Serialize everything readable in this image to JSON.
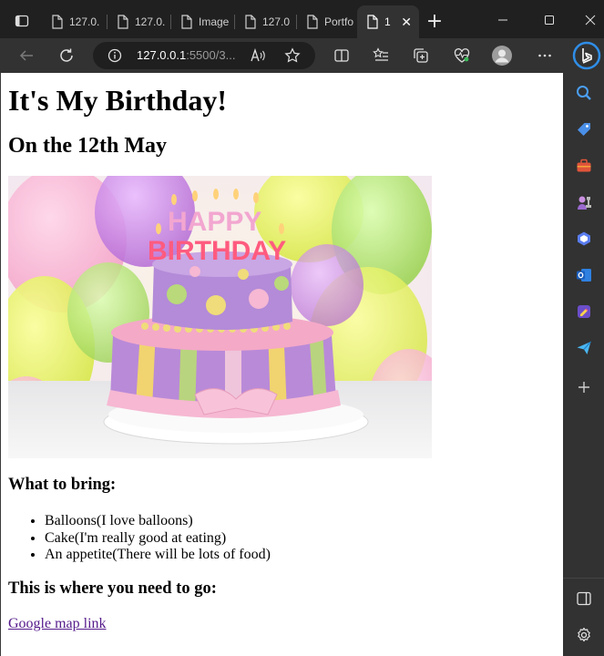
{
  "browser": {
    "tabs": [
      {
        "label": "127.0.",
        "active": false
      },
      {
        "label": "127.0.",
        "active": false
      },
      {
        "label": "Image",
        "active": false
      },
      {
        "label": "127.0",
        "active": false
      },
      {
        "label": "Portfo",
        "active": false
      },
      {
        "label": "1",
        "active": true
      }
    ],
    "new_tab_label": "+",
    "close_tab_label": "✕",
    "address": {
      "host": "127.0.0.1",
      "rest": ":5500/3..."
    },
    "toolbar_icons": [
      "back-icon",
      "refresh-icon",
      "info-icon",
      "read-aloud-icon",
      "favorite-star-icon",
      "split-screen-icon",
      "favorites-icon",
      "collections-icon",
      "browser-essentials-icon",
      "profile-avatar",
      "more-menu-icon"
    ],
    "sidebar_icons": [
      "search-icon",
      "shopping-tag-icon",
      "tools-icon",
      "games-icon",
      "copilot-icon",
      "outlook-icon",
      "drop-icon",
      "send-icon",
      "add-icon",
      "sidebar-toggle-icon",
      "settings-icon"
    ]
  },
  "page": {
    "title": "It's My Birthday!",
    "subtitle": "On the 12th May",
    "cake_text": "HAPPY BIRTHDAY",
    "bring_heading": "What to bring:",
    "bring_items": [
      "Balloons(I love balloons)",
      "Cake(I'm really good at eating)",
      "An appetite(There will be lots of food)"
    ],
    "where_heading": "This is where you need to go:",
    "map_link": "Google map link"
  },
  "colors": {
    "chrome_dark": "#202020",
    "toolbar": "#323232",
    "link_visited": "#551a8b"
  }
}
